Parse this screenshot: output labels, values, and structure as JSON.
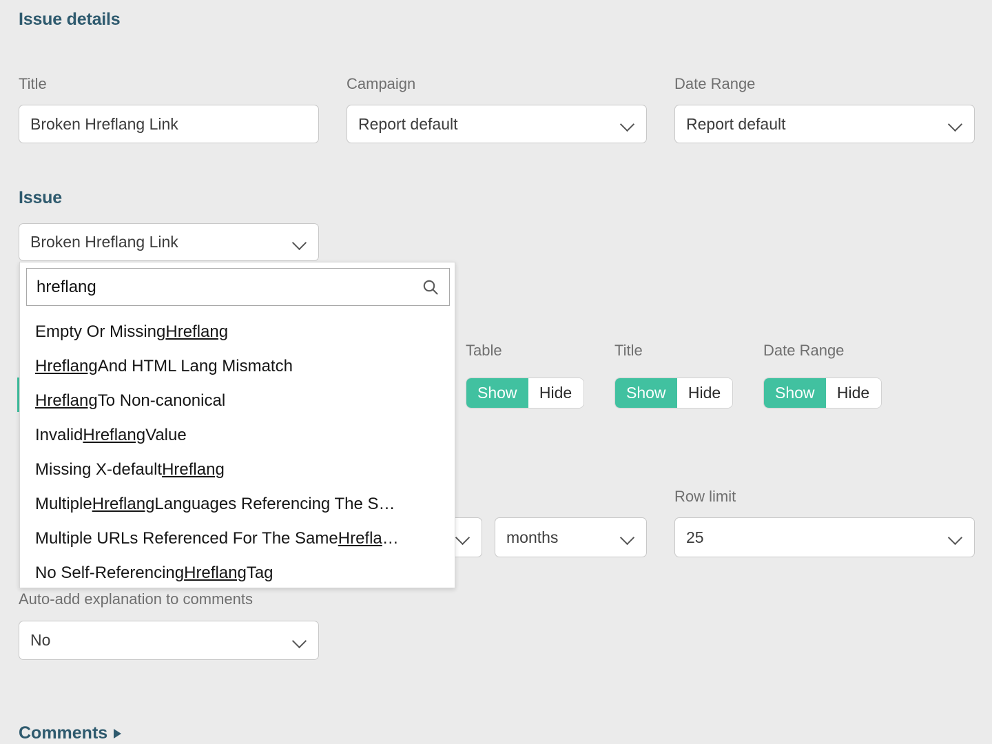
{
  "headings": {
    "issue_details": "Issue details",
    "issue": "Issue",
    "comments": "Comments"
  },
  "top_fields": {
    "title": {
      "label": "Title",
      "value": "Broken Hreflang Link"
    },
    "campaign": {
      "label": "Campaign",
      "value": "Report default"
    },
    "date_range": {
      "label": "Date Range",
      "value": "Report default"
    }
  },
  "issue_select": {
    "value": "Broken Hreflang Link"
  },
  "dropdown": {
    "search_value": "hreflang",
    "search_placeholder": "",
    "search_icon": "search-icon",
    "items": [
      {
        "pre": "Empty Or Missing ",
        "match": "Hreflang",
        "post": ""
      },
      {
        "pre": "",
        "match": "Hreflang",
        "post": " And HTML Lang Mismatch"
      },
      {
        "pre": "",
        "match": "Hreflang",
        "post": " To Non-canonical"
      },
      {
        "pre": "Invalid ",
        "match": "Hreflang",
        "post": " Value"
      },
      {
        "pre": "Missing X-default ",
        "match": "Hreflang",
        "post": ""
      },
      {
        "pre": "Multiple ",
        "match": "Hreflang",
        "post": " Languages Referencing The S…"
      },
      {
        "pre": "Multiple URLs Referenced For The Same ",
        "match": "Hrefla",
        "post": "…"
      },
      {
        "pre": "No Self-Referencing ",
        "match": "Hreflang",
        "post": " Tag"
      }
    ]
  },
  "visibility_toggles": [
    {
      "label": "Table",
      "options": [
        "Show",
        "Hide"
      ],
      "selected": "Show"
    },
    {
      "label": "Title",
      "options": [
        "Show",
        "Hide"
      ],
      "selected": "Show"
    },
    {
      "label": "Date Range",
      "options": [
        "Show",
        "Hide"
      ],
      "selected": "Show"
    }
  ],
  "period": {
    "unit_value": "months"
  },
  "row_limit": {
    "label": "Row limit",
    "value": "25"
  },
  "auto_add": {
    "label": "Auto-add explanation to comments",
    "value": "No"
  },
  "colors": {
    "background": "#ebebeb",
    "heading": "#2e5a6e",
    "accent_green": "#41c1a0",
    "label_grey": "#6f6f6f",
    "control_border": "#c8c8c8"
  }
}
